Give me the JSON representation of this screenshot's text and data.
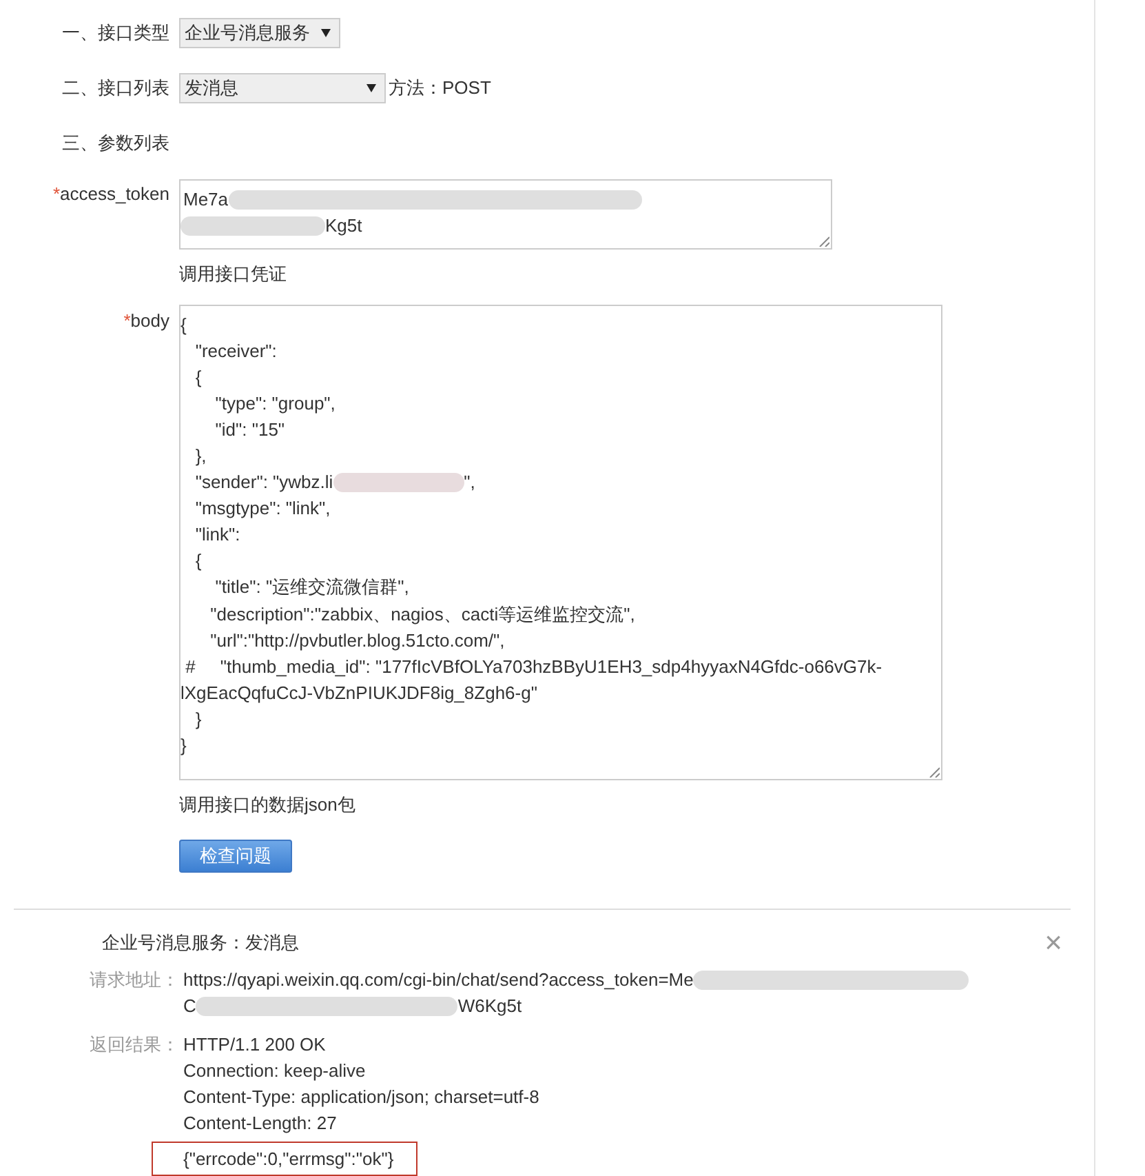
{
  "form": {
    "interface_type": {
      "label": "一、接口类型",
      "value": "企业号消息服务"
    },
    "interface_list": {
      "label": "二、接口列表",
      "value": "发消息",
      "method": "方法：POST"
    },
    "params_heading": "三、参数列表",
    "access_token": {
      "required_mark": "*",
      "label": "access_token",
      "lines": [
        {
          "segments": [
            {
              "kind": "text",
              "text": "Me7a"
            },
            {
              "kind": "blur"
            }
          ]
        },
        {
          "segments": [
            {
              "kind": "blur"
            },
            {
              "kind": "text",
              "text": "Kg5t"
            }
          ]
        }
      ],
      "hint": "调用接口凭证"
    },
    "body": {
      "required_mark": "*",
      "label": "body",
      "lines": [
        {
          "segments": [
            "{"
          ]
        },
        {
          "segments": [
            "   \"receiver\":"
          ]
        },
        {
          "segments": [
            "   {"
          ]
        },
        {
          "segments": [
            "       \"type\": \"group\","
          ]
        },
        {
          "segments": [
            "       \"id\": \"15\""
          ]
        },
        {
          "segments": [
            "   },"
          ]
        },
        {
          "segments": [
            {
              "kind": "text",
              "text": "   \"sender\": \"ywbz.li"
            },
            {
              "kind": "blur"
            },
            {
              "kind": "text",
              "text": "\","
            }
          ]
        },
        {
          "segments": [
            "   \"msgtype\": \"link\","
          ]
        },
        {
          "segments": [
            "   \"link\":"
          ]
        },
        {
          "segments": [
            "   {"
          ]
        },
        {
          "segments": [
            "       \"title\": \"运维交流微信群\","
          ]
        },
        {
          "segments": [
            "      \"description\":\"zabbix、nagios、cacti等运维监控交流\","
          ]
        },
        {
          "segments": [
            "      \"url\":\"http://pvbutler.blog.51cto.com/\","
          ]
        },
        {
          "segments": [
            " #     \"thumb_media_id\": \"177fIcVBfOLYa703hzBByU1EH3_sdp4hyyaxN4Gfdc-o66vG7k-"
          ]
        },
        {
          "segments": [
            "lXgEacQqfuCcJ-VbZnPIUKJDF8ig_8Zgh6-g\""
          ]
        },
        {
          "segments": [
            "   }"
          ]
        },
        {
          "segments": [
            "}"
          ]
        }
      ],
      "hint": "调用接口的数据json包"
    },
    "check_button": "检查问题"
  },
  "result": {
    "title": "企业号消息服务：发消息",
    "close": "×",
    "request_url": {
      "label": "请求地址：",
      "lines": [
        {
          "segments": [
            {
              "kind": "text",
              "text": "https://qyapi.weixin.qq.com/cgi-bin/chat/send?access_token=Me"
            },
            {
              "kind": "blur"
            }
          ]
        },
        {
          "segments": [
            {
              "kind": "text",
              "text": "C"
            },
            {
              "kind": "blur"
            },
            {
              "kind": "text",
              "text": "W6Kg5t"
            }
          ]
        }
      ]
    },
    "response": {
      "label": "返回结果：",
      "lines": [
        "HTTP/1.1 200 OK",
        "Connection: keep-alive",
        "Content-Type: application/json; charset=utf-8",
        "Content-Length: 27"
      ],
      "highlighted_body": "{\"errcode\":0,\"errmsg\":\"ok\"}"
    }
  }
}
